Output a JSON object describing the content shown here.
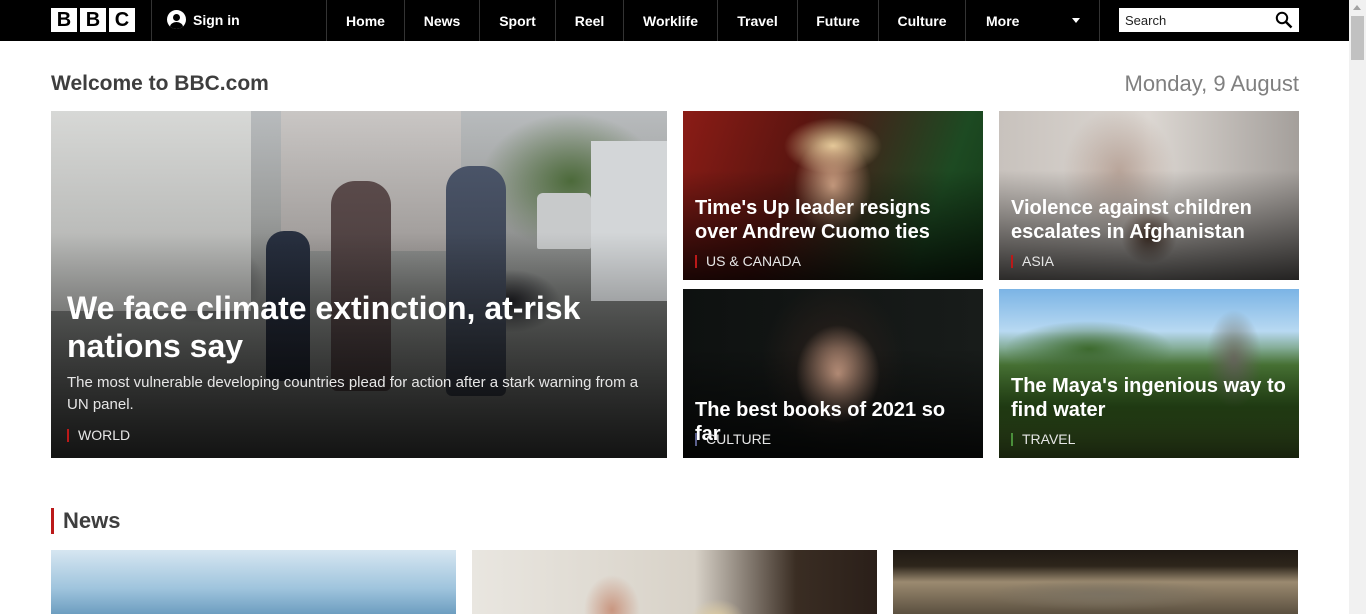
{
  "header": {
    "logo_letters": [
      "B",
      "B",
      "C"
    ],
    "signin_label": "Sign in",
    "nav": [
      {
        "label": "Home",
        "name": "nav-home"
      },
      {
        "label": "News",
        "name": "nav-news"
      },
      {
        "label": "Sport",
        "name": "nav-sport"
      },
      {
        "label": "Reel",
        "name": "nav-reel"
      },
      {
        "label": "Worklife",
        "name": "nav-worklife"
      },
      {
        "label": "Travel",
        "name": "nav-travel"
      },
      {
        "label": "Future",
        "name": "nav-future"
      },
      {
        "label": "Culture",
        "name": "nav-culture"
      },
      {
        "label": "More",
        "name": "nav-more"
      }
    ],
    "search_placeholder": "Search"
  },
  "welcome": {
    "title": "Welcome to BBC.com",
    "date": "Monday, 9 August"
  },
  "hero": {
    "headline": "We face climate extinction, at-risk nations say",
    "summary": "The most vulnerable developing countries plead for action after a stark warning from a UN panel.",
    "tag": "WORLD",
    "tag_color": "#bb1919"
  },
  "stories": [
    {
      "headline": "Time's Up leader resigns over Andrew Cuomo ties",
      "tag": "US & CANADA",
      "tag_color": "#bb1919"
    },
    {
      "headline": "Violence against children escalates in Afghanistan",
      "tag": "ASIA",
      "tag_color": "#bb1919"
    },
    {
      "headline": "The best books of 2021 so far",
      "tag": "CULTURE",
      "tag_color": "#5a5f8c"
    },
    {
      "headline": "The Maya's ingenious way to find water",
      "tag": "TRAVEL",
      "tag_color": "#4a8f3a"
    }
  ],
  "news_section": {
    "title": "News",
    "accent": "#bb1919"
  }
}
